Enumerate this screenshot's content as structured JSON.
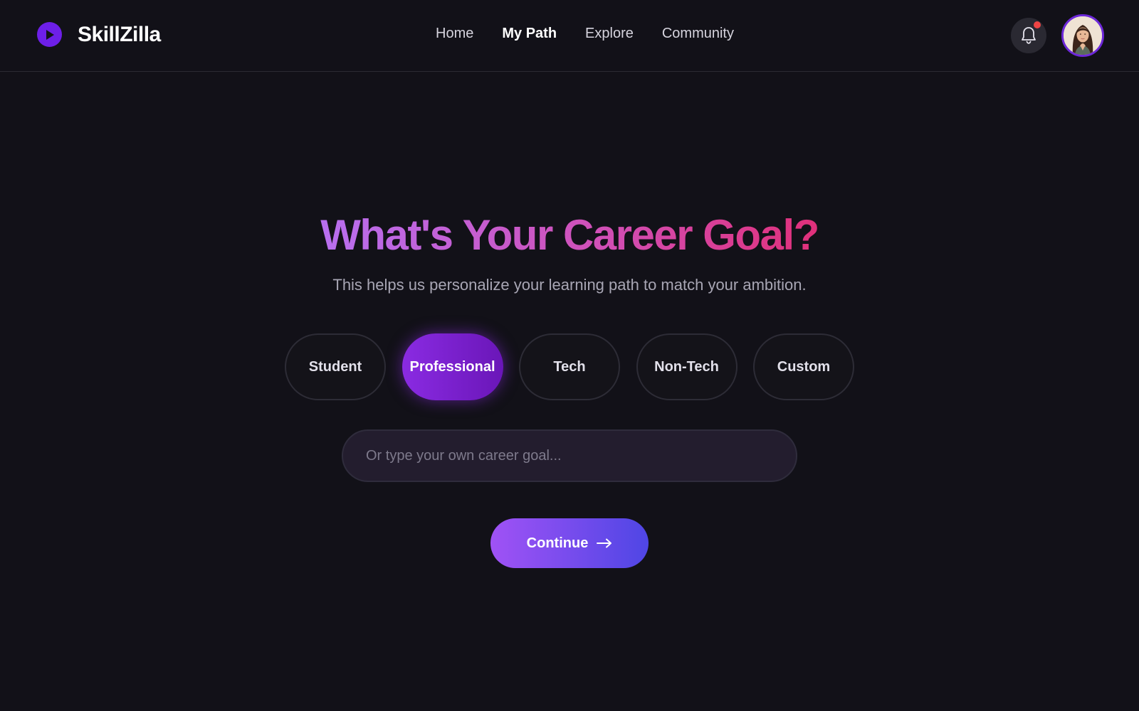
{
  "header": {
    "brand": {
      "name": "SkillZilla",
      "icon": "play-circle-icon",
      "color": "#6d1fe8"
    },
    "nav": [
      {
        "label": "Home",
        "active": false
      },
      {
        "label": "My Path",
        "active": true
      },
      {
        "label": "Explore",
        "active": false
      },
      {
        "label": "Community",
        "active": false
      }
    ],
    "notifications": {
      "icon": "bell-icon",
      "has_unread": true,
      "dot_color": "#ef4444"
    },
    "avatar": {
      "icon": "user-avatar",
      "ring_color": "#6d28d9"
    }
  },
  "main": {
    "title": "What's Your Career Goal?",
    "subtitle": "This helps us personalize your learning path to match your ambition.",
    "options": [
      {
        "label": "Student",
        "selected": false
      },
      {
        "label": "Professional",
        "selected": true
      },
      {
        "label": "Tech",
        "selected": false
      },
      {
        "label": "Non-Tech",
        "selected": false
      },
      {
        "label": "Custom",
        "selected": false
      }
    ],
    "goal_input": {
      "placeholder": "Or type your own career goal...",
      "value": ""
    },
    "continue_label": "Continue",
    "continue_icon": "arrow-right-icon"
  }
}
